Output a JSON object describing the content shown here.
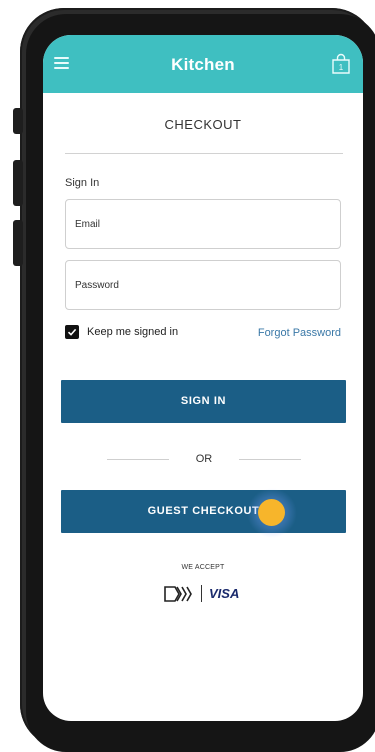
{
  "header": {
    "brand": "Kitchen",
    "menu_icon": "hamburger-menu-icon",
    "cart_icon": "shopping-bag-icon",
    "cart_count": "1",
    "color": "#3fbfc1"
  },
  "checkout": {
    "title": "CHECKOUT",
    "sign_in_label": "Sign In",
    "email_placeholder": "Email",
    "password_placeholder": "Password",
    "keep_signed_in": "Keep me signed in",
    "keep_signed_in_checked": true,
    "forgot_password": "Forgot Password",
    "sign_in_button": "SIGN IN",
    "or_text": "OR",
    "guest_checkout_button": "GUEST CHECKOUT",
    "button_color": "#1b5e86",
    "link_color": "#3a78a7"
  },
  "payment": {
    "we_accept": "WE ACCEPT",
    "card_icon": "payment-card-logo-icon",
    "visa": "VISA"
  }
}
